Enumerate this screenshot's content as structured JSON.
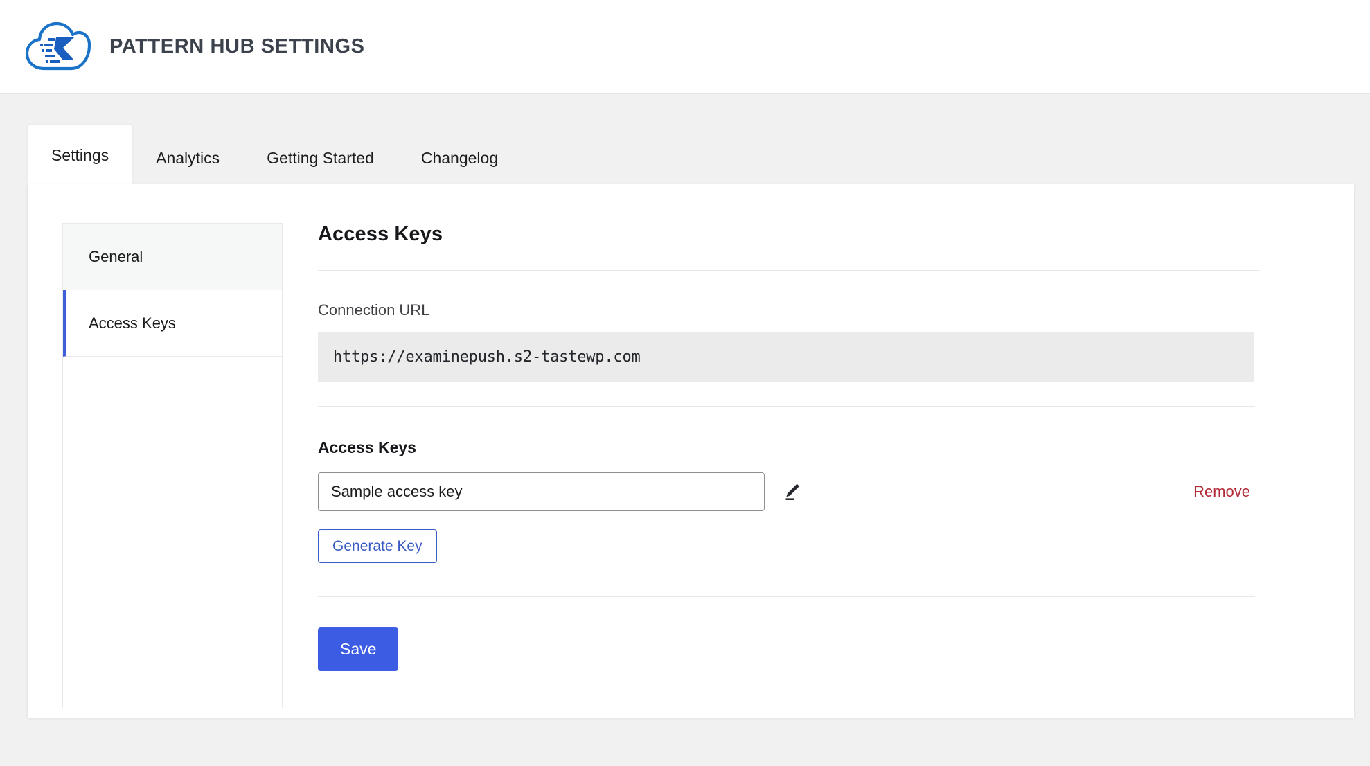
{
  "header": {
    "title": "PATTERN HUB SETTINGS",
    "logo_icon": "cloud-speed-logo-icon",
    "logo_color": "#1a73c8"
  },
  "tabs": [
    {
      "label": "Settings",
      "active": true
    },
    {
      "label": "Analytics",
      "active": false
    },
    {
      "label": "Getting Started",
      "active": false
    },
    {
      "label": "Changelog",
      "active": false
    }
  ],
  "settings_nav": {
    "items": [
      {
        "label": "General",
        "current": false
      },
      {
        "label": "Access Keys",
        "current": true
      }
    ],
    "active_indicator_color": "#3f5fd8"
  },
  "panel": {
    "title": "Access Keys",
    "connection_url": {
      "label": "Connection URL",
      "value": "https://examinepush.s2-tastewp.com"
    },
    "access_keys": {
      "subhead": "Access Keys",
      "key_value": "Sample access key",
      "key_placeholder": "Sample access key",
      "edit_icon": "pencil-icon",
      "remove_label": "Remove",
      "remove_color": "#b02a37",
      "generate_label": "Generate Key",
      "generate_color": "#3b5bc4"
    },
    "save_label": "Save",
    "save_color": "#3c5ce4"
  }
}
